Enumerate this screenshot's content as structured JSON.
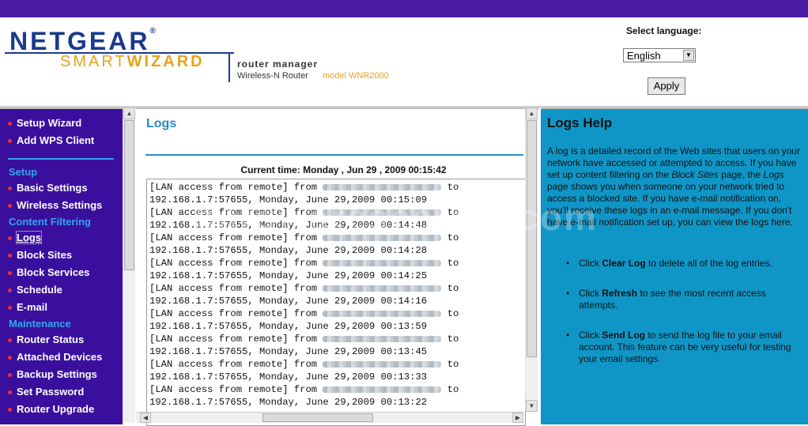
{
  "header": {
    "brand": "NETGEAR",
    "brand_reg": "®",
    "product_smart": "SMART",
    "product_wizard": "WIZARD",
    "router_manager": "router manager",
    "router_type": "Wireless-N Router",
    "model": "model WNR2000"
  },
  "language": {
    "label": "Select language:",
    "selected": "English",
    "apply": "Apply"
  },
  "sidebar": {
    "top_items": [
      {
        "label": "Setup Wizard"
      },
      {
        "label": "Add WPS Client"
      }
    ],
    "sections": {
      "setup": "Setup",
      "content_filtering": "Content Filtering",
      "maintenance": "Maintenance"
    },
    "items": [
      {
        "label": "Basic Settings"
      },
      {
        "label": "Wireless Settings"
      },
      {
        "label": "Logs"
      },
      {
        "label": "Block Sites"
      },
      {
        "label": "Block Services"
      },
      {
        "label": "Schedule"
      },
      {
        "label": "E-mail"
      },
      {
        "label": "Router Status"
      },
      {
        "label": "Attached Devices"
      },
      {
        "label": "Backup Settings"
      },
      {
        "label": "Set Password"
      },
      {
        "label": "Router Upgrade"
      }
    ]
  },
  "main": {
    "title": "Logs",
    "current_time": "Current time: Monday , Jun 29 , 2009 00:15:42",
    "log_entries": [
      {
        "line1": "[LAN access from remote] from ",
        "suffix": " to",
        "line2": "192.168.1.7:57655, Monday, June 29,2009 00:15:09"
      },
      {
        "line1": "[LAN access from remote] from ",
        "suffix": " to",
        "line2": "192.168.1.7:57655, Monday, June 29,2009 00:14:48"
      },
      {
        "line1": "[LAN access from remote] from ",
        "suffix": " to",
        "line2": "192.168.1.7:57655, Monday, June 29,2009 00:14:28"
      },
      {
        "line1": "[LAN access from remote] from ",
        "suffix": " to",
        "line2": "192.168.1.7:57655, Monday, June 29,2009 00:14:25"
      },
      {
        "line1": "[LAN access from remote] from ",
        "suffix": " to",
        "line2": "192.168.1.7:57655, Monday, June 29,2009 00:14:16"
      },
      {
        "line1": "[LAN access from remote] from ",
        "suffix": " to",
        "line2": "192.168.1.7:57655, Monday, June 29,2009 00:13:59"
      },
      {
        "line1": "[LAN access from remote] from ",
        "suffix": " to",
        "line2": "192.168.1.7:57655, Monday, June 29,2009 00:13:45"
      },
      {
        "line1": "[LAN access from remote] from ",
        "suffix": " to",
        "line2": "192.168.1.7:57655, Monday, June 29,2009 00:13:33"
      },
      {
        "line1": "[LAN access from remote] from ",
        "suffix": " to",
        "line2": "192.168.1.7:57655, Monday, June 29,2009 00:13:22"
      }
    ]
  },
  "help": {
    "title": "Logs Help",
    "intro_1": "A log is a detailed record of the Web sites that users on your network have accessed or attempted to access. If you have set up content filtering on the ",
    "intro_block_sites": "Block Sites",
    "intro_2": " page, the ",
    "intro_logs": "Logs",
    "intro_3": " page shows you when someone on your network tried to access a blocked site. If you have e-mail notification on, you'll receive these logs in an e-mail message. If you don't have e-mail notification set up, you can view the logs here.",
    "items": [
      {
        "pre": "Click ",
        "bold": "Clear Log",
        "post": " to delete all of the log entries."
      },
      {
        "pre": "Click ",
        "bold": "Refresh",
        "post": " to see the most recent access attempts."
      },
      {
        "pre": "Click ",
        "bold": "Send Log",
        "post": " to send the log file to your email account. This feature can be very useful for testing your email settings."
      }
    ]
  },
  "watermark": "hardwaresecrets.com",
  "colors": {
    "topbar": "#4a1aa3",
    "sidebar": "#3a0f9e",
    "section": "#32a6ee",
    "help_bg": "#1096c6",
    "title": "#2788c8"
  }
}
